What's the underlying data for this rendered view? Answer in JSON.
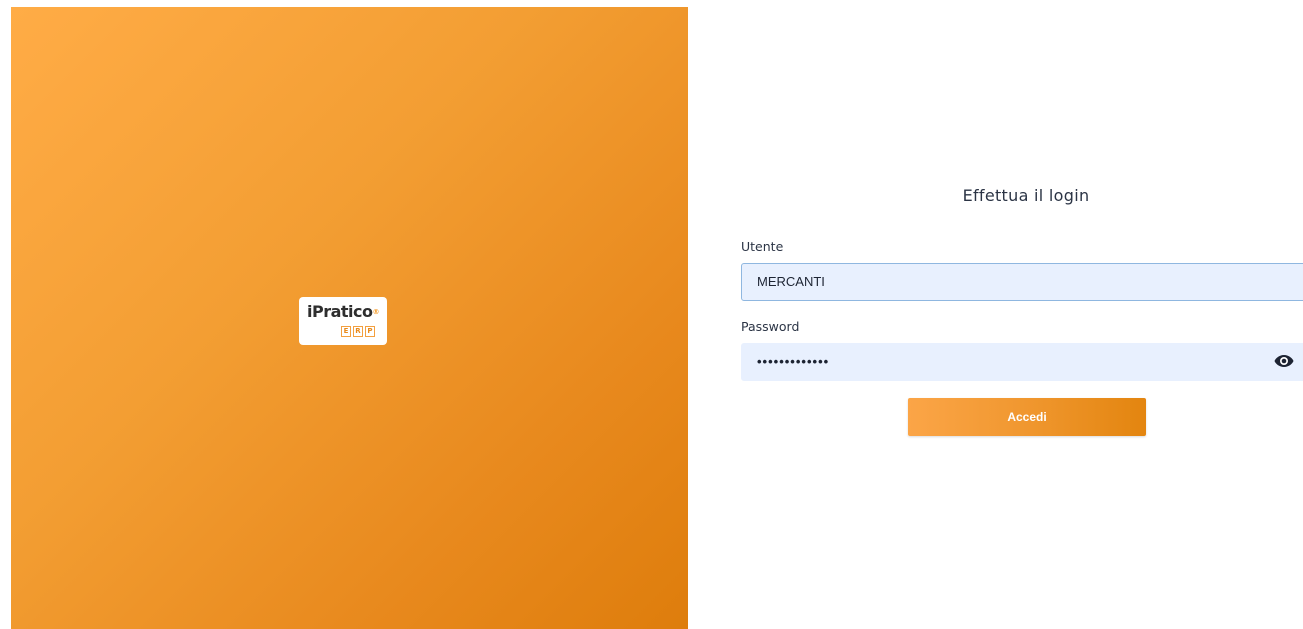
{
  "brand": {
    "logo_name": "iPratico",
    "logo_mark": "®",
    "logo_sub_letters": [
      "E",
      "R",
      "P"
    ]
  },
  "login": {
    "title": "Effettua il login",
    "user_label": "Utente",
    "user_value": "MERCANTI",
    "password_label": "Password",
    "password_mask": "•••••••••••••",
    "show_password_icon": "eye-icon",
    "submit_label": "Accedi"
  },
  "colors": {
    "accent": "#f39e33",
    "accent_dark": "#de7d0c",
    "input_bg": "#e8f0fe",
    "text": "#2b3445"
  }
}
